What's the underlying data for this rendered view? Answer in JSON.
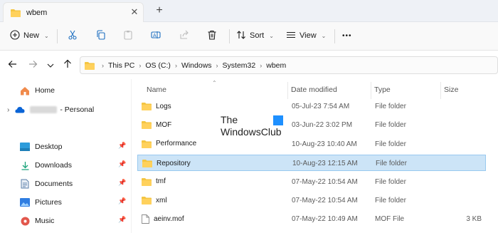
{
  "tab": {
    "title": "wbem",
    "close_glyph": "✕",
    "new_tab_glyph": "+"
  },
  "commandbar": {
    "new_label": "New",
    "sort_label": "Sort",
    "view_label": "View",
    "more_glyph": "•••"
  },
  "breadcrumb": [
    "This PC",
    "OS (C:)",
    "Windows",
    "System32",
    "wbem"
  ],
  "sidebar": {
    "home": "Home",
    "personal": "- Personal",
    "items": [
      {
        "label": "Desktop",
        "icon": "desktop-icon"
      },
      {
        "label": "Downloads",
        "icon": "downloads-icon"
      },
      {
        "label": "Documents",
        "icon": "documents-icon"
      },
      {
        "label": "Pictures",
        "icon": "pictures-icon"
      },
      {
        "label": "Music",
        "icon": "music-icon"
      }
    ]
  },
  "columns": {
    "name": "Name",
    "date": "Date modified",
    "type": "Type",
    "size": "Size"
  },
  "files": [
    {
      "name": "Logs",
      "date": "05-Jul-23 7:54 AM",
      "type": "File folder",
      "size": "",
      "kind": "folder"
    },
    {
      "name": "MOF",
      "date": "03-Jun-22 3:02 PM",
      "type": "File folder",
      "size": "",
      "kind": "folder"
    },
    {
      "name": "Performance",
      "date": "10-Aug-23 10:40 AM",
      "type": "File folder",
      "size": "",
      "kind": "folder"
    },
    {
      "name": "Repository",
      "date": "10-Aug-23 12:15 AM",
      "type": "File folder",
      "size": "",
      "kind": "folder",
      "selected": true
    },
    {
      "name": "tmf",
      "date": "07-May-22 10:54 AM",
      "type": "File folder",
      "size": "",
      "kind": "folder"
    },
    {
      "name": "xml",
      "date": "07-May-22 10:54 AM",
      "type": "File folder",
      "size": "",
      "kind": "folder"
    },
    {
      "name": "aeinv.mof",
      "date": "07-May-22 10:49 AM",
      "type": "MOF File",
      "size": "3 KB",
      "kind": "file"
    }
  ],
  "watermark": {
    "line1": "The",
    "line2": "WindowsClub"
  },
  "colors": {
    "folder": "#f4c542",
    "selection": "#cce4f7",
    "accent": "#0067c0"
  }
}
